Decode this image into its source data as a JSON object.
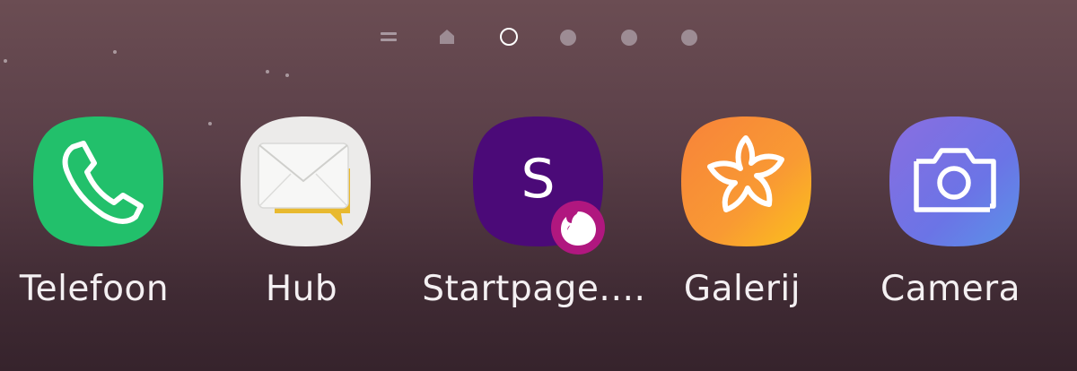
{
  "page_indicator": {
    "items": [
      "menu-indicator",
      "home-indicator",
      "page-dot-current",
      "page-dot",
      "page-dot",
      "page-dot"
    ],
    "current_index": 2
  },
  "dock": {
    "apps": [
      {
        "label": "Telefoon",
        "icon": "phone-icon",
        "color": "#22c06b"
      },
      {
        "label": "Hub",
        "icon": "envelope-icon",
        "color": "#ecebea"
      },
      {
        "label": "Startpage.…",
        "icon": "startpage-s-icon",
        "color": "#4b0a78",
        "badge_icon": "firefox-badge-icon",
        "badge_color": "#b0177f"
      },
      {
        "label": "Galerij",
        "icon": "flower-icon",
        "color": "#f7833a"
      },
      {
        "label": "Camera",
        "icon": "camera-icon",
        "color": "#6b74e6"
      }
    ]
  },
  "startpage": {
    "letter": "S"
  }
}
